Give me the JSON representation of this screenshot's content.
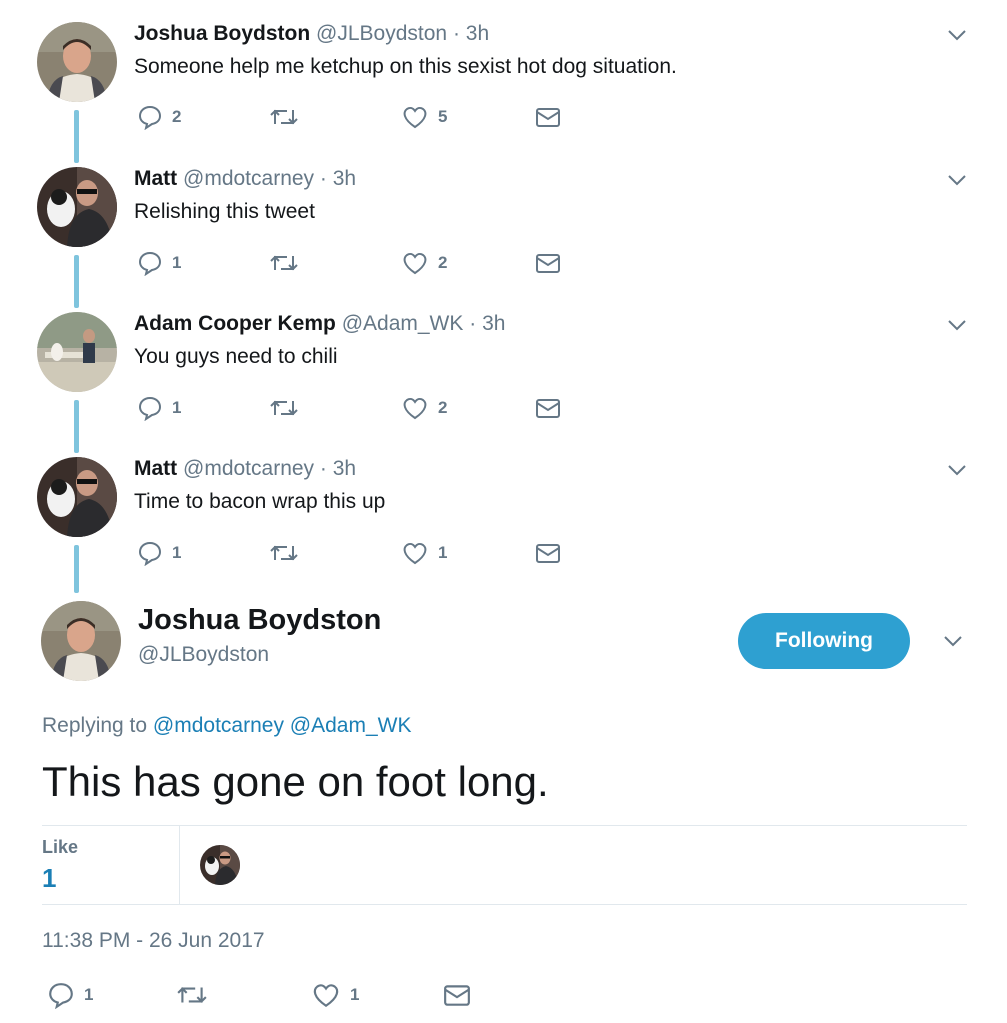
{
  "replies": [
    {
      "name": "Joshua Boydston",
      "handle": "@JLBoydston",
      "dot": "·",
      "time": "3h",
      "text": "Someone help me ketchup on this sexist hot dog situation.",
      "replies": "2",
      "retweets": "",
      "likes": "5"
    },
    {
      "name": "Matt",
      "handle": "@mdotcarney",
      "dot": "·",
      "time": "3h",
      "text": "Relishing this tweet",
      "replies": "1",
      "retweets": "",
      "likes": "2"
    },
    {
      "name": "Adam Cooper Kemp",
      "handle": "@Adam_WK",
      "dot": "·",
      "time": "3h",
      "text": "You guys need to chili",
      "replies": "1",
      "retweets": "",
      "likes": "2"
    },
    {
      "name": "Matt",
      "handle": "@mdotcarney",
      "dot": "·",
      "time": "3h",
      "text": "Time to bacon wrap this up",
      "replies": "1",
      "retweets": "",
      "likes": "1"
    }
  ],
  "focus": {
    "name": "Joshua Boydston",
    "handle": "@JLBoydston",
    "follow_label": "Following",
    "replying_prefix": "Replying to",
    "mention_1": "@mdotcarney",
    "mention_2": "@Adam_WK",
    "text": "This has gone on foot long.",
    "like_label": "Like",
    "like_count": "1",
    "timestamp": "11:38 PM - 26 Jun 2017",
    "replies": "1",
    "likes": "1"
  },
  "icons": {
    "reply": "reply-icon",
    "retweet": "retweet-icon",
    "like": "heart-icon",
    "dm": "envelope-icon",
    "more": "chevron-down-icon"
  },
  "colors": {
    "accent": "#2ea0d1",
    "link": "#1b7fb5",
    "muted": "#657786",
    "thread_line": "#7fc4dd"
  }
}
